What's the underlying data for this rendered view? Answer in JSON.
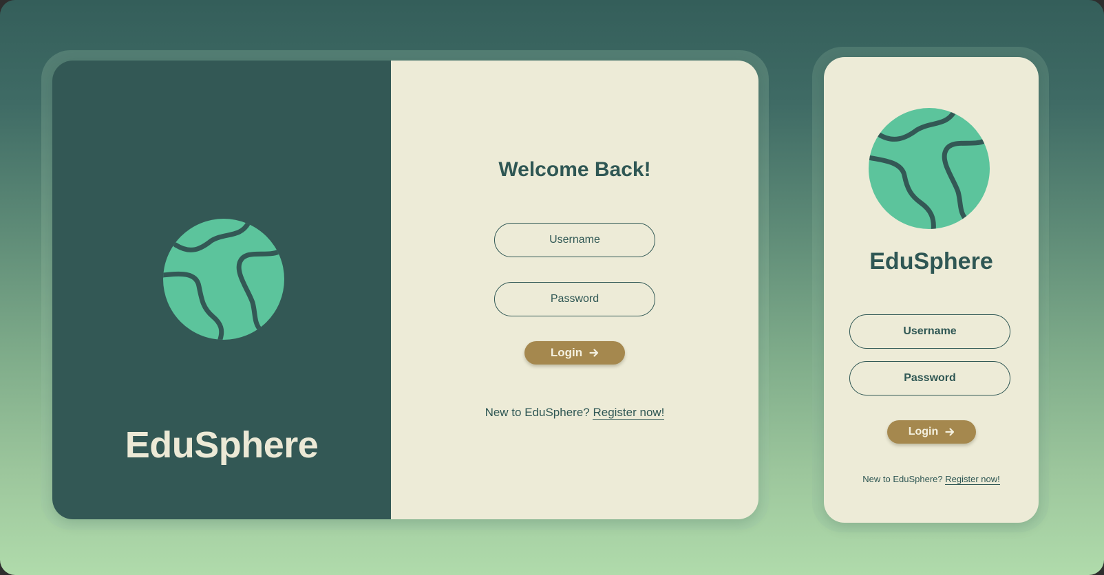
{
  "brand": {
    "name": "EduSphere",
    "globe_color": "#5cc49c",
    "panel_color": "#335855",
    "cream_color": "#edebd7",
    "accent_color": "#a5884e"
  },
  "desktop": {
    "heading": "Welcome Back!",
    "username_placeholder": "Username",
    "password_placeholder": "Password",
    "login_label": "Login",
    "register_prompt": "New to EduSphere?",
    "register_link": "Register now!"
  },
  "mobile": {
    "username_placeholder": "Username",
    "password_placeholder": "Password",
    "login_label": "Login",
    "register_prompt": "New to EduSphere?",
    "register_link": "Register now!"
  },
  "icons": {
    "globe": "globe-icon",
    "arrow": "arrow-right-icon"
  }
}
